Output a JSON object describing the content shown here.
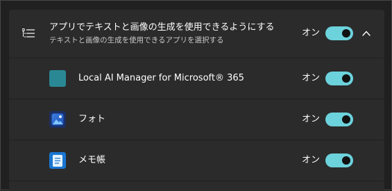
{
  "colors": {
    "toggle_on": "#6cd2dc",
    "card_bg": "#2b2b2b",
    "window_bg": "#202020"
  },
  "setting": {
    "icon": "list-icon",
    "title": "アプリでテキストと画像の生成を使用できるようにする",
    "subtitle": "テキストと画像の生成を使用できるアプリを選択する",
    "state": "オン",
    "enabled": true,
    "expanded": true,
    "chevron_icon": "chevron-up-icon"
  },
  "apps": [
    {
      "name": "Local AI Manager for Microsoft® 365",
      "state": "オン",
      "enabled": true,
      "icon": "local-ai-manager-icon"
    },
    {
      "name": "フォト",
      "state": "オン",
      "enabled": true,
      "icon": "photos-icon"
    },
    {
      "name": "メモ帳",
      "state": "オン",
      "enabled": true,
      "icon": "notepad-icon"
    }
  ]
}
